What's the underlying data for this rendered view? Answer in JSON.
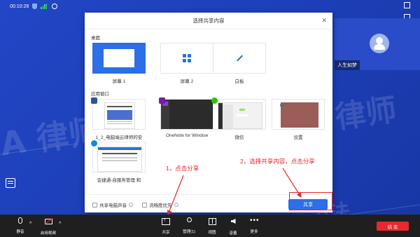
{
  "status_bar": {
    "time": "00:10:28"
  },
  "participant": {
    "name": "人生如梦"
  },
  "watermark": {
    "text_left": "A 律师",
    "text_right": "律师",
    "text_bottom": "—e法"
  },
  "dialog": {
    "title": "选择共享内容",
    "desktop_section": "桌面",
    "desktop_items": [
      {
        "label": "屏幕 1",
        "selected": true
      },
      {
        "label": "屏幕 2",
        "selected": false
      },
      {
        "label": "白板",
        "selected": false
      }
    ],
    "app_section": "应用窗口",
    "app_items": [
      {
        "label": "1_2_电脑端云律师的安"
      },
      {
        "label": "OneNote for Window"
      },
      {
        "label": "微信"
      },
      {
        "label": "设置"
      },
      {
        "label": "会捷通-自服务管理 和"
      }
    ],
    "share_audio_label": "共享电脑声音",
    "smooth_priority_label": "流畅度优先",
    "share_button": "共享"
  },
  "annotations": {
    "step1": "1，点击分享",
    "step2": "2，选择共享内容，点击分享"
  },
  "toolbar": {
    "mute": "静音",
    "video": "启用视频",
    "share": "共享",
    "manage": "管理(1)",
    "view": "视图",
    "volume": "音量",
    "more": "更多",
    "end": "结 束"
  },
  "colors": {
    "accent": "#2c6fe6",
    "annotation": "#e8282e",
    "background": "#1f3fb8"
  }
}
